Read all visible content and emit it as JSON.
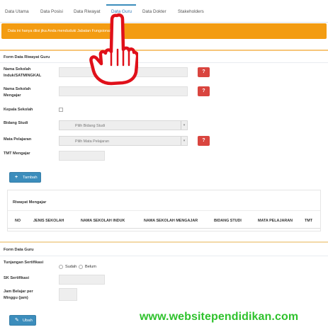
{
  "tabs": [
    {
      "label": "Data Utama",
      "active": false
    },
    {
      "label": "Data Posisi",
      "active": false
    },
    {
      "label": "Data Riwayat",
      "active": false
    },
    {
      "label": "Data Guru",
      "active": true
    },
    {
      "label": "Data Dokter",
      "active": false
    },
    {
      "label": "Stakeholders",
      "active": false
    }
  ],
  "alert": {
    "text": "Data ini hanya diisi jika Anda menduduki Jabatan Fungsional Guru",
    "color": "#f39c12"
  },
  "riwayat_form": {
    "title": "Form Data Riwayat Guru",
    "nama_sekolah_induk_label": "Nama Sekolah Induk/SATMINGKAL",
    "nama_sekolah_mengajar_label": "Nama Sekolah Mengajar",
    "kepala_sekolah_label": "Kepala Sekolah",
    "bidang_studi_label": "Bidang Studi",
    "bidang_studi_placeholder": "Pilih Bidang Studi",
    "mata_pelajaran_label": "Mata Pelajaran",
    "mata_pelajaran_placeholder": "Pilih Mata Pelajaran",
    "tmt_mengajar_label": "TMT Mengajar",
    "help_glyph": "?",
    "tambah_button": "Tambah",
    "tambah_icon": "+"
  },
  "riwayat_table": {
    "title": "Riwayat Mengajar",
    "columns": [
      "NO",
      "JENIS SEKOLAH",
      "NAMA SEKOLAH INDUK",
      "NAMA SEKOLAH MENGAJAR",
      "BIDANG STUDI",
      "MATA PELAJARAN",
      "TMT"
    ]
  },
  "guru_form": {
    "title": "Form Data Guru",
    "tunjangan_label": "Tunjangan Sertifikasi",
    "option_sudah": "Sudah",
    "option_belum": "Belum",
    "sk_label": "SK Sertifikasi",
    "jam_label": "Jam Belajar per Minggu (jam)",
    "ubah_button": "Ubah",
    "ubah_icon": "✎"
  },
  "watermark": "www.websitependidikan.com",
  "colors": {
    "accent": "#3c8dbc",
    "warning": "#f39c12",
    "danger": "#d9453f",
    "watermark": "#2fc22d",
    "pointer": "#e0101a"
  },
  "pointer_icon": "pointing-hand-icon"
}
